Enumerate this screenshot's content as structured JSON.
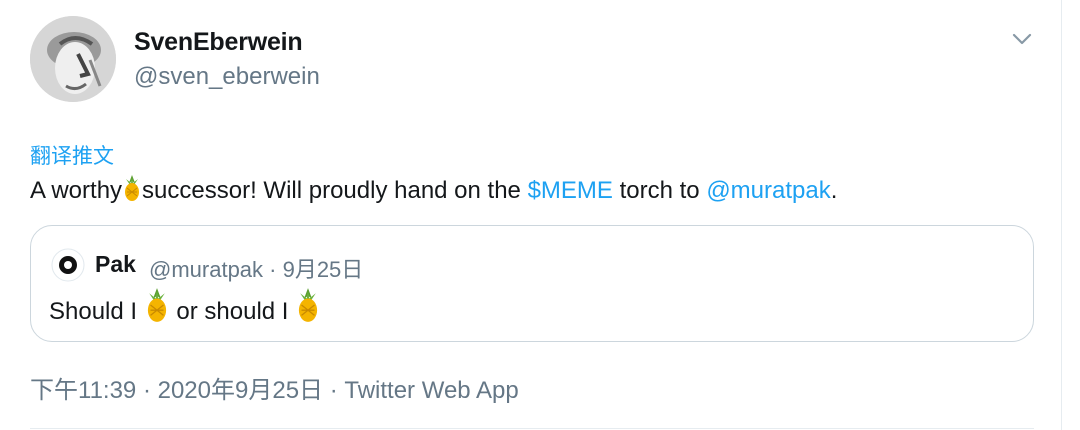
{
  "author": {
    "display_name": "SvenEberwein",
    "handle": "@sven_eberwein"
  },
  "translate_label": "翻译推文",
  "tweet": {
    "text_part1": "A worthy",
    "text_part2": "successor! Will proudly hand on the ",
    "cashtag": "$MEME",
    "text_part3": " torch to ",
    "mention": "@muratpak",
    "text_part4": "."
  },
  "quoted_tweet": {
    "display_name": "Pak",
    "meta": "@muratpak · 9月25日",
    "text_part1": "Should I ",
    "text_part2": " or should I "
  },
  "footer": {
    "time": "下午11:39 · 2020年9月25日",
    "separator": " · ",
    "source": "Twitter Web App"
  },
  "icons": {
    "menu": "chevron-down-icon",
    "emoji": "pineapple-icon",
    "quoted_avatar": "circle-logo-icon"
  },
  "colors": {
    "link": "#1da1f2",
    "secondary": "#657786",
    "border": "#ccd6dd"
  }
}
